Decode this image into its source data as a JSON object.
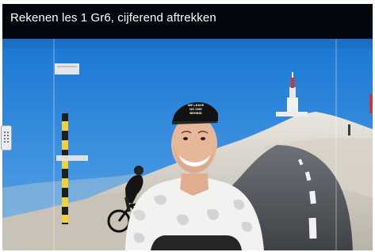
{
  "video": {
    "title": "Rekenen les 1 Gr6, cijferend aftrekken",
    "subtitle": "",
    "cap_text_line1": "WE LEAVE",
    "cap_text_line2": "NO ONE BEHIND"
  },
  "colors": {
    "sky": "#1a7fd4",
    "title_bar": "#000000",
    "title_text": "#ffffff"
  },
  "icons": {
    "side_handle": "grip-icon"
  }
}
